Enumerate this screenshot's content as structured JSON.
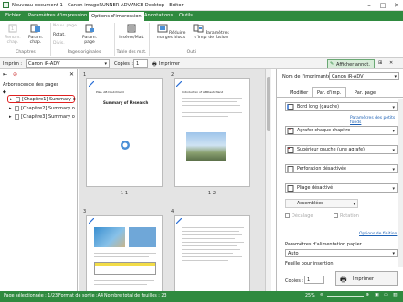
{
  "window": {
    "title": "Nouveau document 1 - Canon imageRUNNER ADVANCE Desktop - Editor",
    "minimize": "–",
    "maximize": "□",
    "close": "✕"
  },
  "tabs": [
    "Fichier",
    "Paramètres d'impression",
    "Options d'impression",
    "Annotations",
    "Outils"
  ],
  "ribbon": {
    "renum": "Renum. chap.",
    "param_chap": "Param. chap.",
    "nouv_page": "Nouv. page",
    "rotat": "Rotat.",
    "divis": "Divis.",
    "param_page": "Param. page",
    "inserer": "Insérer/Mat.",
    "reduire": "Réduire marges blocs",
    "fusion": "Paramètres d'imp. de fusion",
    "groups": [
      "Chapitres",
      "Pages originales",
      "Table des mat.",
      "Outil"
    ]
  },
  "toolbar": {
    "imprim_label": "Imprim :",
    "printer": "Canon iR-ADV",
    "copies_label": "Copies :",
    "copies_value": "1",
    "imprimer": "Imprimer",
    "afficher": "Afficher annot."
  },
  "tree": {
    "header": "Arborescence des pages",
    "items": [
      "[Chapitre1] Summary o",
      "[Chapitre2] Summary o",
      "[Chapitre3] Summary o"
    ]
  },
  "pages": [
    {
      "num": "1",
      "label": "1-1",
      "doc_title": "Summary of Research",
      "header": "Plan. AB Deutchland"
    },
    {
      "num": "2",
      "label": "1-2",
      "header": "Introduction of AB Deutchland"
    },
    {
      "num": "3"
    },
    {
      "num": "4"
    }
  ],
  "right": {
    "printer_label": "Nom de l'imprimante :",
    "printer_name": "Canon iR-ADV",
    "tabs": [
      "Modifier",
      "Par. d'imp.",
      "Par. page"
    ],
    "reliure": "Bord long (gauche)",
    "link1": "Paramètres des petits fonds",
    "agrafer": "Agrafer chaque chapitre",
    "superieur": "Supérieur gauche (une agrafe)",
    "perforation": "Perforation désactivée",
    "pliage": "Pliage désactivé",
    "assemblees": "Assemblées",
    "decalage": "Décalage",
    "rotation": "Rotation",
    "link2": "Options de finition",
    "alim_label": "Paramètres d'alimentation papier",
    "alim_value": "Auto",
    "feuilles_label": "Feuille pour insertion",
    "copies_label": "Copies :",
    "copies_value": "1",
    "imprimer": "Imprimer"
  },
  "status": {
    "selected": "Page sélectionnée : 1/23",
    "format": "Format de sortie :A4",
    "sheets": "Nombre total de feuilles : 23",
    "zoom": "25%"
  }
}
